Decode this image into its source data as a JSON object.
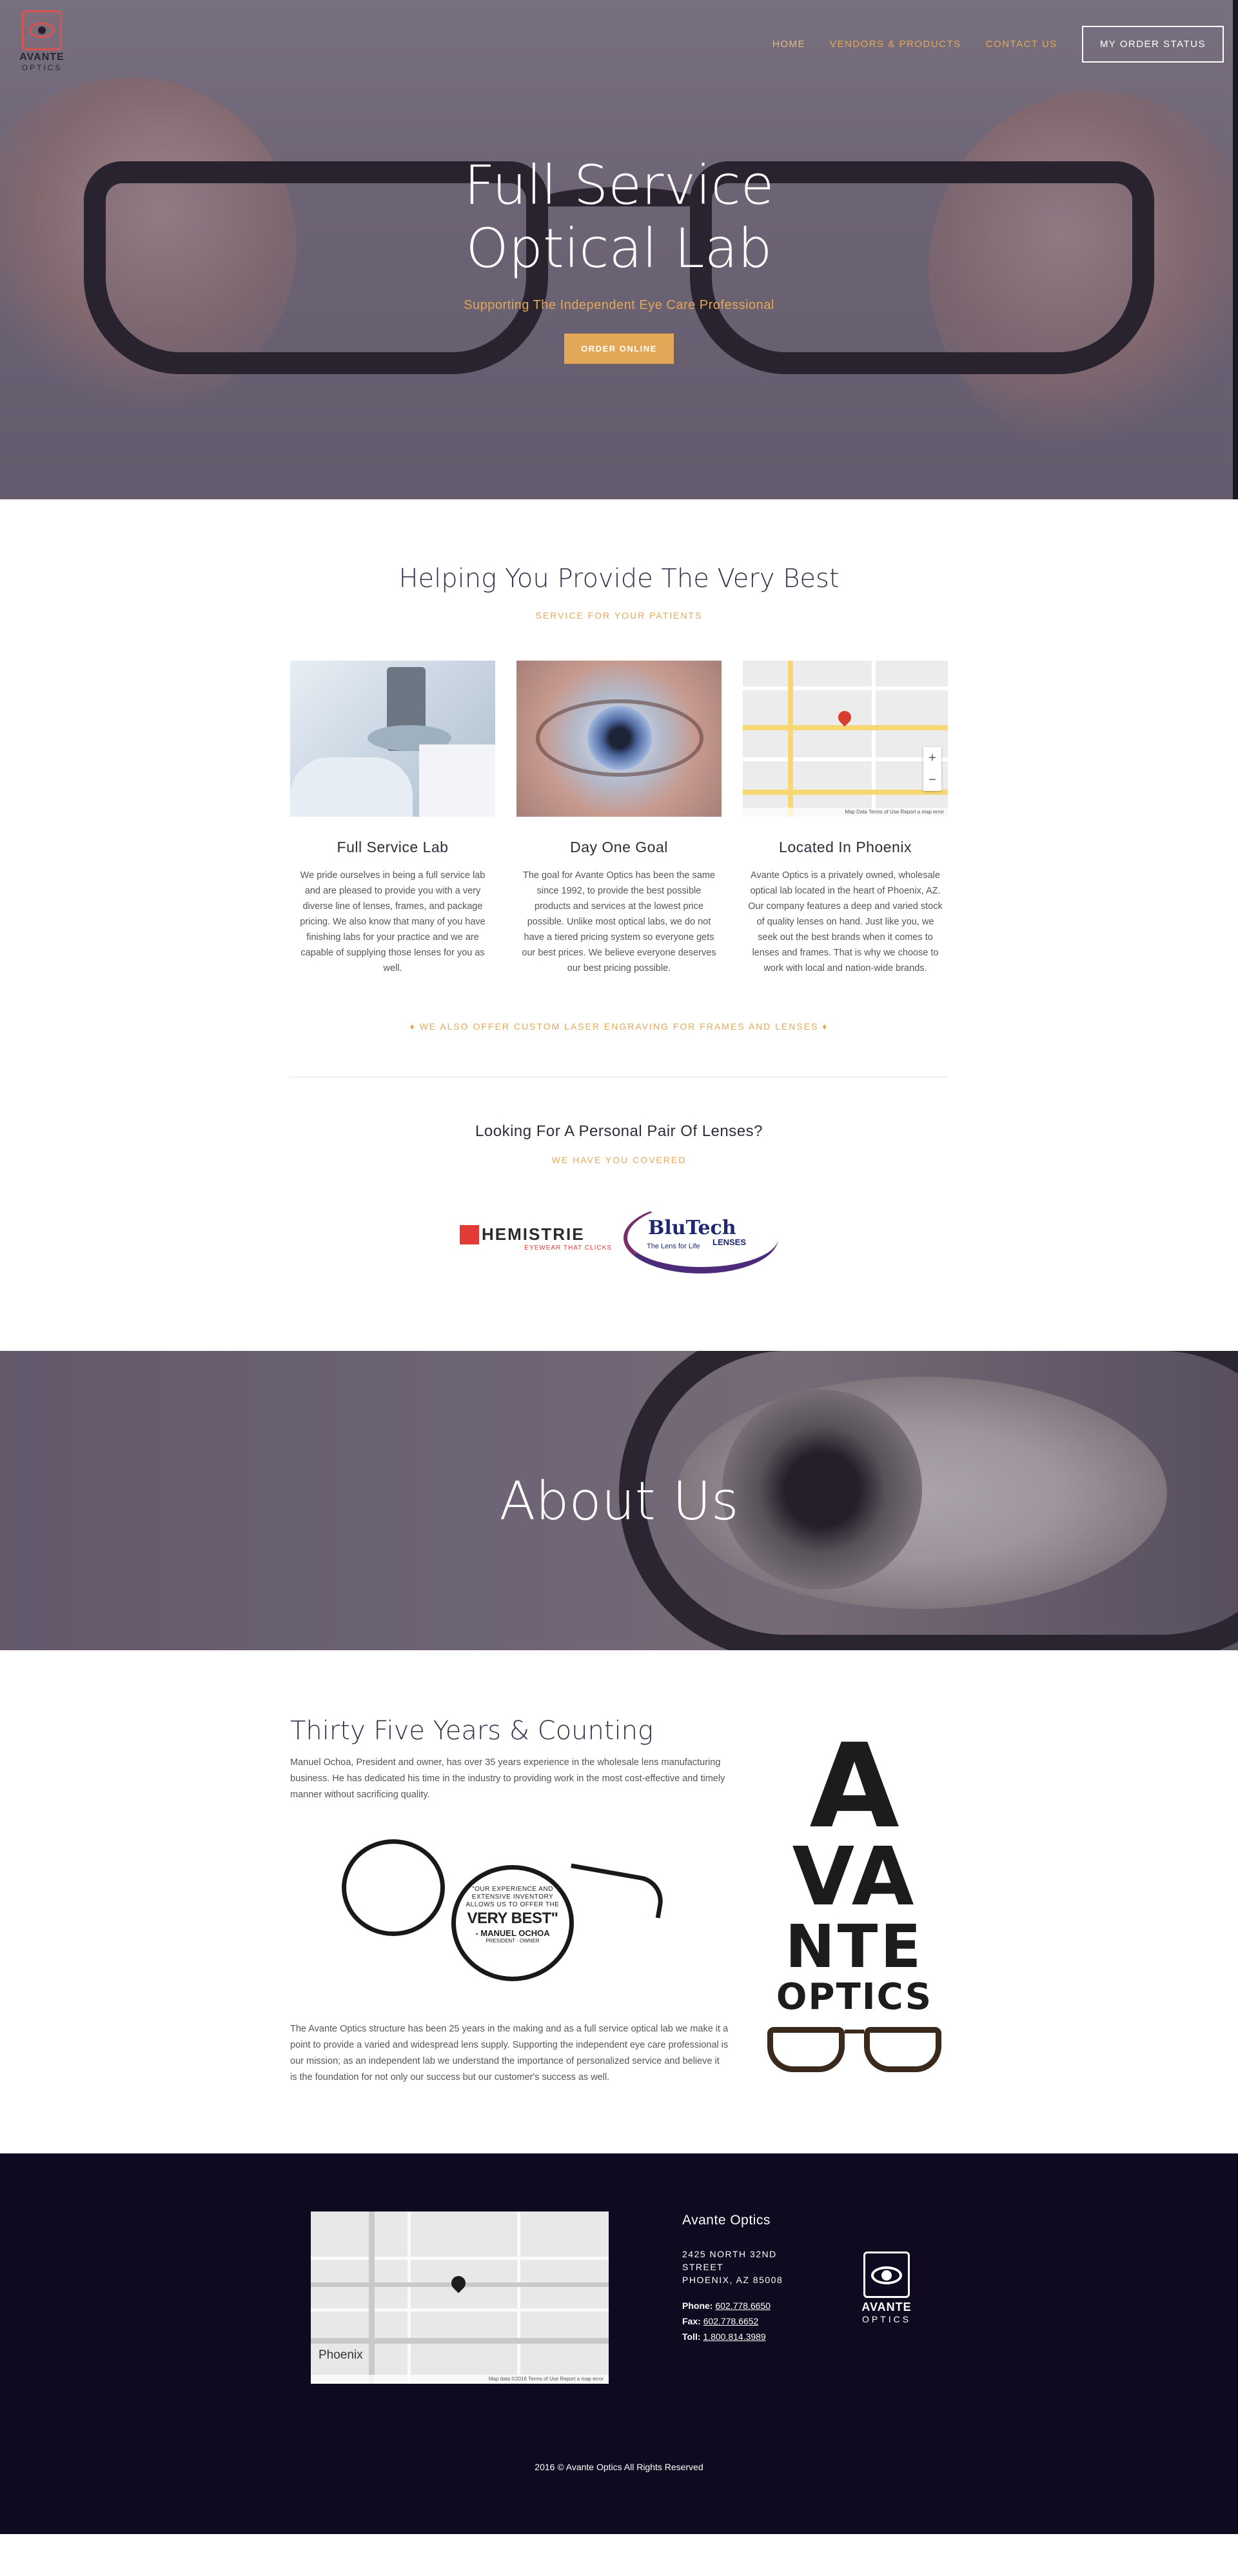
{
  "brand": {
    "logo_line1": "AVANTE",
    "logo_line2": "OPTICS",
    "accent": "#e3a857",
    "footer_bg": "#0f0a1f"
  },
  "nav": {
    "items": [
      {
        "label": "HOME"
      },
      {
        "label": "VENDORS & PRODUCTS"
      },
      {
        "label": "CONTACT US"
      }
    ],
    "order_status": "MY ORDER STATUS"
  },
  "hero": {
    "title_line1": "Full Service",
    "title_line2": "Optical Lab",
    "subtitle": "Supporting The Independent Eye Care Professional",
    "cta": "ORDER ONLINE"
  },
  "services": {
    "title": "Helping You Provide The Very Best",
    "kicker": "SERVICE FOR YOUR PATIENTS",
    "cards": [
      {
        "title": "Full Service Lab",
        "body": "We pride ourselves in being a full service lab and are pleased to provide you with a very diverse line of lenses, frames, and package pricing. We also know that many of you have finishing labs for your practice and we are capable of supplying those lenses for you as well."
      },
      {
        "title": "Day One Goal",
        "body": "The goal for Avante Optics has been the same since 1992, to provide the best possible products and services at the lowest price possible. Unlike most optical labs, we do not have a tiered pricing system so everyone gets our best prices. We believe everyone deserves our best pricing possible."
      },
      {
        "title": "Located In Phoenix",
        "body": "Avante Optics is a privately owned, wholesale optical lab located in the heart of Phoenix, AZ. Our company features a deep and varied stock of quality lenses on hand. Just like you, we seek out the best brands when it comes to lenses and frames. That is why we choose to work with local and nation-wide brands."
      }
    ],
    "map_zoom_in": "+",
    "map_zoom_out": "−",
    "map_footer": "Map Data   Terms of Use   Report a map error",
    "engraving": "♦ WE ALSO OFFER CUSTOM LASER ENGRAVING FOR FRAMES AND LENSES ♦"
  },
  "lenses": {
    "title": "Looking For A Personal Pair Of Lenses?",
    "kicker": "WE HAVE YOU COVERED",
    "chemistrie": {
      "name": "HEMISTRIE",
      "tagline": "EYEWEAR THAT CLICKS"
    },
    "blutech": {
      "name": "BluTech",
      "sub": "LENSES",
      "tagline": "The Lens for Life"
    }
  },
  "about_banner": {
    "title": "About Us"
  },
  "about": {
    "title": "Thirty Five Years & Counting",
    "p1": "Manuel Ochoa, President and owner, has over 35 years experience in the wholesale lens manufacturing business. He has dedicated his time in the industry to providing work in the most cost-effective and timely manner without sacrificing quality.",
    "glasses_small": "\"OUR EXPERIENCE AND EXTENSIVE INVENTORY ALLOWS US TO OFFER THE",
    "glasses_big": "VERY BEST\"",
    "glasses_name": "- MANUEL OCHOA",
    "glasses_role": "PRESIDENT - OWNER",
    "p2": "The Avante Optics structure has been 25 years in the making and as a full service optical lab we make it a point to provide a varied and widespread lens supply. Supporting the independent eye care professional is our mission; as an independent lab we understand the importance of personalized service and believe it is the foundation for not only our success but our customer's success as well.",
    "big_logo": {
      "a": "A",
      "va": "VA",
      "nte": "NTE",
      "optics": "OPTICS"
    }
  },
  "footer": {
    "map_city": "Phoenix",
    "map_footer": "Map data ©2016   Terms of Use   Report a map error",
    "name": "Avante Optics",
    "addr1": "2425 NORTH 32ND",
    "addr2": "STREET",
    "addr3": "PHOENIX, AZ 85008",
    "phone_label": "Phone:",
    "phone": "602.778.6650",
    "fax_label": "Fax:",
    "fax": "602.778.6652",
    "toll_label": "Toll:",
    "toll": "1.800.814.3989",
    "copyright": "2016 © Avante Optics All Rights Reserved"
  }
}
